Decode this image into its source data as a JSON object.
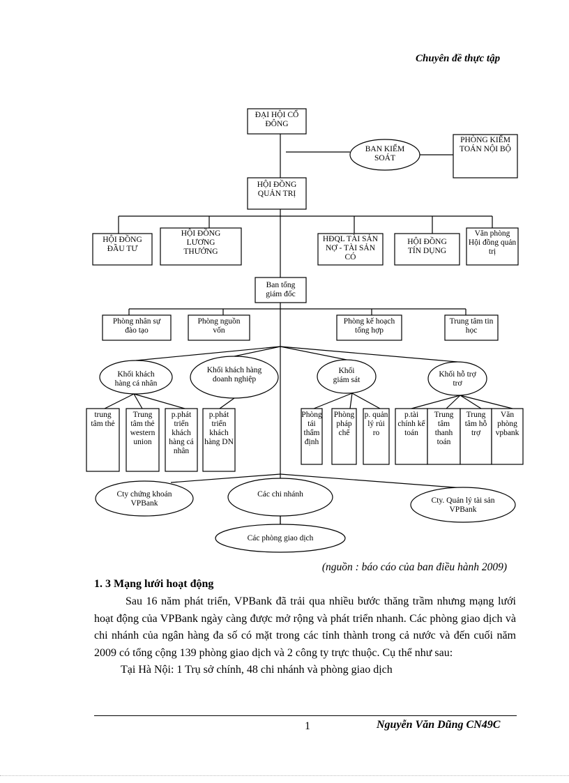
{
  "header": {
    "title": "Chuyên đề thực tập"
  },
  "org_chart": {
    "nodes": [
      {
        "id": "dhcd",
        "lines": [
          "ĐẠI HỘI CỔ",
          "ĐÔNG"
        ]
      },
      {
        "id": "bks",
        "lines": [
          "BAN KIỂM",
          "SOÁT"
        ]
      },
      {
        "id": "pktnb",
        "lines": [
          "PHÒNG KIỂM",
          "TOÁN NỘI BỘ"
        ]
      },
      {
        "id": "hdqt",
        "lines": [
          "HỘI ĐỒNG",
          "QUẢN TRỊ"
        ]
      },
      {
        "id": "hddt",
        "lines": [
          "HỘI ĐỒNG",
          "ĐẦU TƯ"
        ]
      },
      {
        "id": "hdlt",
        "lines": [
          "HỘI ĐỒNG",
          "LƯƠNG",
          "THƯỞNG"
        ]
      },
      {
        "id": "hdql",
        "lines": [
          "HĐQL TÀI SẢN",
          "NỢ - TÀI SẢN",
          "CÓ"
        ]
      },
      {
        "id": "hdtd",
        "lines": [
          "HỘI ĐỒNG",
          "TÍN DỤNG"
        ]
      },
      {
        "id": "vphd",
        "lines": [
          "Văn phòng",
          "Hội đồng quản",
          "trị"
        ]
      },
      {
        "id": "btgd",
        "lines": [
          "Ban tổng",
          "giám đốc"
        ]
      },
      {
        "id": "pns",
        "lines": [
          "Phòng nhân sự",
          "đào tạo"
        ]
      },
      {
        "id": "pnv",
        "lines": [
          "Phòng nguồn",
          "vốn"
        ]
      },
      {
        "id": "pkh",
        "lines": [
          "Phòng kế hoạch",
          "tổng hợp"
        ]
      },
      {
        "id": "tttin",
        "lines": [
          "Trung tâm tin",
          "học"
        ]
      },
      {
        "id": "kcn",
        "lines": [
          "Khối khách",
          "hàng cá nhân"
        ]
      },
      {
        "id": "kdn",
        "lines": [
          "Khối khách hàng",
          "doanh nghiệp"
        ]
      },
      {
        "id": "kgs",
        "lines": [
          "Khối",
          "giám sát"
        ]
      },
      {
        "id": "kht",
        "lines": [
          "Khối hỗ trợ",
          "trơ"
        ]
      },
      {
        "id": "ttthe",
        "lines": [
          "trung",
          "tâm thẻ"
        ]
      },
      {
        "id": "ttwu",
        "lines": [
          "Trung",
          "tâm thẻ",
          "western",
          "union"
        ]
      },
      {
        "id": "ppcn",
        "lines": [
          "p.phát",
          "triển",
          "khách",
          "hàng cá",
          "nhân"
        ]
      },
      {
        "id": "ppdn",
        "lines": [
          "p.phát",
          "triển",
          "khách",
          "hàng DN"
        ]
      },
      {
        "id": "ptd",
        "lines": [
          "Phòng",
          "tái",
          "thẩm",
          "định"
        ]
      },
      {
        "id": "ppc",
        "lines": [
          "Phòng",
          "pháp",
          "chế"
        ]
      },
      {
        "id": "pqlrr",
        "lines": [
          "p. quản",
          "lý rủi",
          "ro"
        ]
      },
      {
        "id": "ptckt",
        "lines": [
          "p.tài",
          "chính kế",
          "toán"
        ]
      },
      {
        "id": "tttt",
        "lines": [
          "Trung",
          "tâm",
          "thanh",
          "toán"
        ]
      },
      {
        "id": "ttht",
        "lines": [
          "Trung",
          "tâm hỗ",
          "trợ"
        ]
      },
      {
        "id": "vpvp",
        "lines": [
          "Văn",
          "phòng",
          "vpbank"
        ]
      },
      {
        "id": "ctck",
        "lines": [
          "Cty chứng khoán",
          "VPBank"
        ]
      },
      {
        "id": "ccn",
        "lines": [
          "Các chi nhánh"
        ]
      },
      {
        "id": "ctql",
        "lines": [
          "Cty. Quản lý tài sản",
          "VPBank"
        ]
      },
      {
        "id": "cpgd",
        "lines": [
          "Các phòng giao dịch"
        ]
      }
    ]
  },
  "source_note": "(nguồn : báo cáo của ban điều hành 2009)",
  "section": {
    "heading": "1. 3 Mạng lưới hoạt động",
    "paragraph1": "Sau 16 năm phát triển, VPBank đã trải qua nhiều bước thăng trầm nhưng mạng lưới hoạt động của VPBank ngày càng được mở rộng và phát triển nhanh. Các phòng giao dịch và chi nhánh của ngân hàng đa số có mặt trong các tỉnh thành trong cả nước và đến cuối năm 2009 có tổng cộng 139 phòng giao dịch và 2 công ty trực thuộc. Cụ thể như sau:",
    "paragraph2": "Tại Hà Nội: 1 Trụ sở chính, 48 chi nhánh và phòng giao dịch"
  },
  "footer": {
    "page_number": "1",
    "author": "Nguyễn Văn Dũng CN49C"
  }
}
